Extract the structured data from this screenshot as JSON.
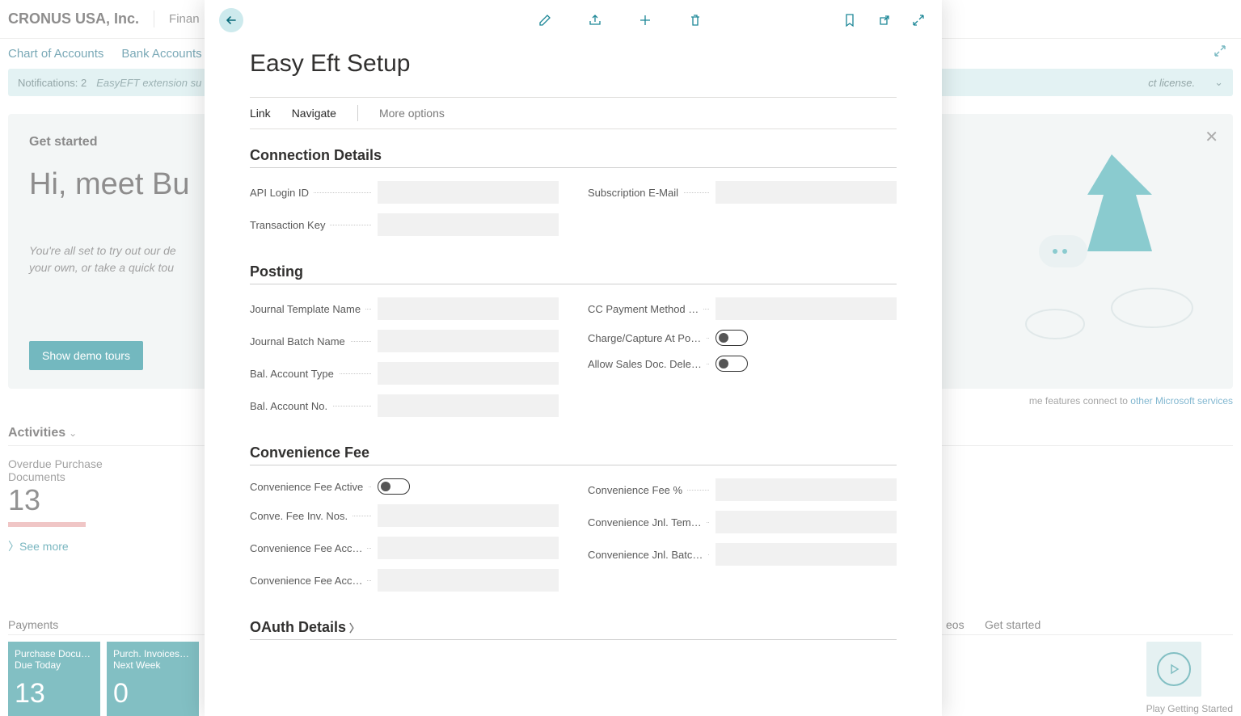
{
  "header": {
    "company": "CRONUS USA, Inc.",
    "nav": "Finan"
  },
  "subnav": {
    "chart": "Chart of Accounts",
    "bank": "Bank Accounts"
  },
  "notification": {
    "count": "Notifications: 2",
    "msg": "EasyEFT extension su",
    "license": "ct license."
  },
  "hero": {
    "started": "Get started",
    "title": "Hi, meet Bu",
    "sub1": "You're all set to try out our de",
    "sub2": "your own, or take a quick tou",
    "button": "Show demo tours",
    "connect_text": "me features connect to ",
    "connect_link": "other Microsoft services"
  },
  "activities": {
    "header": "Activities",
    "sec_label": "Overdue Purchase Documents",
    "value": "13",
    "see_more": "See more"
  },
  "bottom": {
    "payments_label": "Payments",
    "videos_label": "eos",
    "get_started_label": "Get started",
    "tile1_title": "Purchase Docu… Due Today",
    "tile1_num": "13",
    "tile2_title": "Purch. Invoices… Next Week",
    "tile2_num": "0",
    "play_label": "Play Getting Started"
  },
  "modal": {
    "title": "Easy Eft Setup",
    "actions": {
      "link": "Link",
      "navigate": "Navigate",
      "more": "More options"
    },
    "section1": {
      "title": "Connection Details",
      "api_login": "API Login ID",
      "trans_key": "Transaction Key",
      "sub_email": "Subscription E-Mail"
    },
    "section2": {
      "title": "Posting",
      "jtn": "Journal Template Name",
      "jbn": "Journal Batch Name",
      "bat": "Bal. Account Type",
      "ban": "Bal. Account No.",
      "ccpm": "CC Payment Method …",
      "cc_charge": "Charge/Capture At Po…",
      "allow": "Allow Sales Doc. Dele…"
    },
    "section3": {
      "title": "Convenience Fee",
      "active": "Convenience Fee Active",
      "nos": "Conve. Fee Inv. Nos.",
      "acc1": "Convenience Fee Acc…",
      "acc2": "Convenience Fee Acc…",
      "pct": "Convenience Fee %",
      "jnl_tmpl": "Convenience Jnl. Tem…",
      "jnl_batch": "Convenience Jnl. Batc…"
    },
    "section4": {
      "title": "OAuth Details"
    }
  }
}
